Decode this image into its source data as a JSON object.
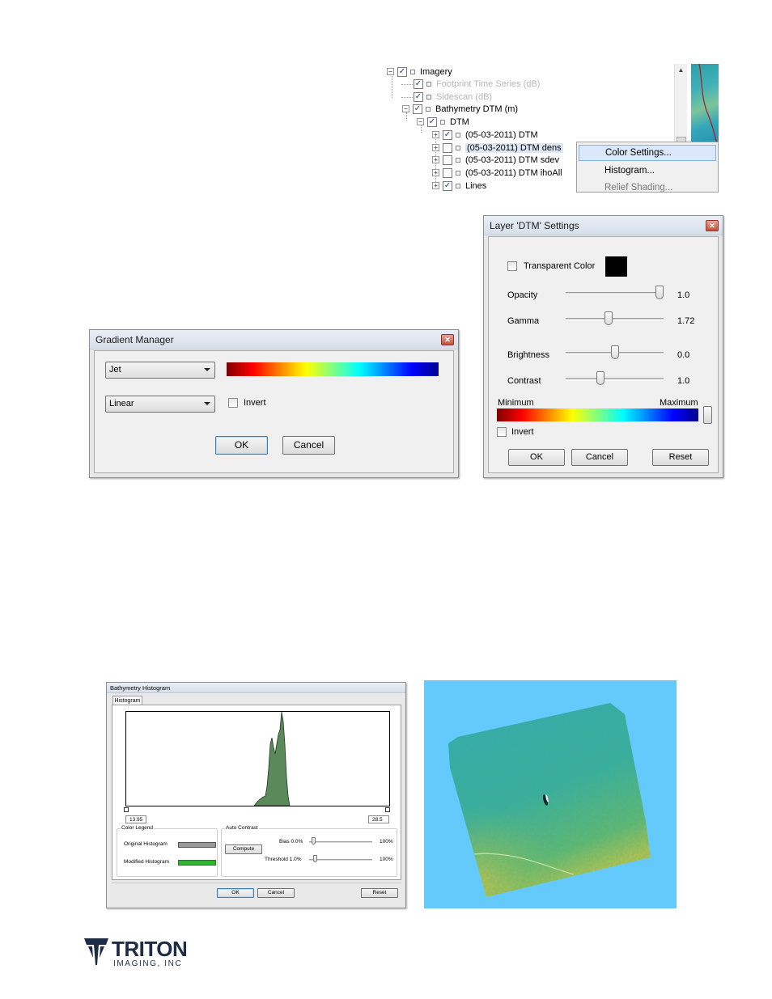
{
  "tree": {
    "rows": [
      {
        "label": "Imagery",
        "checked": true,
        "dim": false
      },
      {
        "label": "Footprint Time Series (dB)",
        "checked": true,
        "dim": true
      },
      {
        "label": "Sidescan (dB)",
        "checked": true,
        "dim": true
      },
      {
        "label": "Bathymetry DTM (m)",
        "checked": true,
        "dim": false
      },
      {
        "label": "DTM",
        "checked": true,
        "dim": false
      },
      {
        "label": "(05-03-2011) DTM",
        "checked": true,
        "dim": false
      },
      {
        "label": "(05-03-2011) DTM dens",
        "checked": false,
        "dim": false
      },
      {
        "label": "(05-03-2011) DTM sdev",
        "checked": false,
        "dim": false
      },
      {
        "label": "(05-03-2011) DTM ihoAll",
        "checked": false,
        "dim": false
      },
      {
        "label": "Lines",
        "checked": true,
        "dim": false
      }
    ],
    "expander_symbol": "−",
    "expander_collapsed_symbol": "+",
    "check_symbol": "✓"
  },
  "context_menu": {
    "items": [
      "Color Settings...",
      "Histogram...",
      "Relief Shading..."
    ]
  },
  "gradient_manager": {
    "title": "Gradient Manager",
    "gradient_select": "Jet",
    "scale_select": "Linear",
    "invert_label": "Invert",
    "ok_label": "OK",
    "cancel_label": "Cancel"
  },
  "layer_settings": {
    "title": "Layer 'DTM' Settings",
    "transparent_color_label": "Transparent Color",
    "transparent_color": "#000000",
    "sliders": [
      {
        "label": "Opacity",
        "value": "1.0",
        "level": 1.0
      },
      {
        "label": "Gamma",
        "value": "1.72",
        "level": 0.43
      },
      {
        "label": "Brightness",
        "value": "0.0",
        "level": 0.5
      },
      {
        "label": "Contrast",
        "value": "1.0",
        "level": 0.34
      }
    ],
    "minimum_label": "Minimum",
    "maximum_label": "Maximum",
    "invert_label": "Invert",
    "ok_label": "OK",
    "cancel_label": "Cancel",
    "reset_label": "Reset"
  },
  "histogram": {
    "title": "Bathymetry Histogram",
    "tab_label": "Histogram",
    "min_value": "13.95",
    "max_value": "28.5",
    "color_legend_label": "Color Legend",
    "original_label": "Original Histogram",
    "modified_label": "Modified Histogram",
    "original_color": "#9a9a9a",
    "modified_color": "#2fb532",
    "auto_contrast_label": "Auto Contrast",
    "compute_label": "Compute",
    "bias_label": "Bias  0.0%",
    "bias_max": "100%",
    "threshold_label": "Threshold  1.0%",
    "threshold_max": "100%",
    "ok_label": "OK",
    "cancel_label": "Cancel",
    "reset_label": "Reset",
    "fill_color": "#5a8a5a"
  },
  "logo": {
    "brand": "TRITON",
    "sub": "IMAGING, INC"
  },
  "colors": {
    "window_bg": "#f0f0f0",
    "close_button": "#c6503b",
    "map_water": "#64c9fb"
  }
}
